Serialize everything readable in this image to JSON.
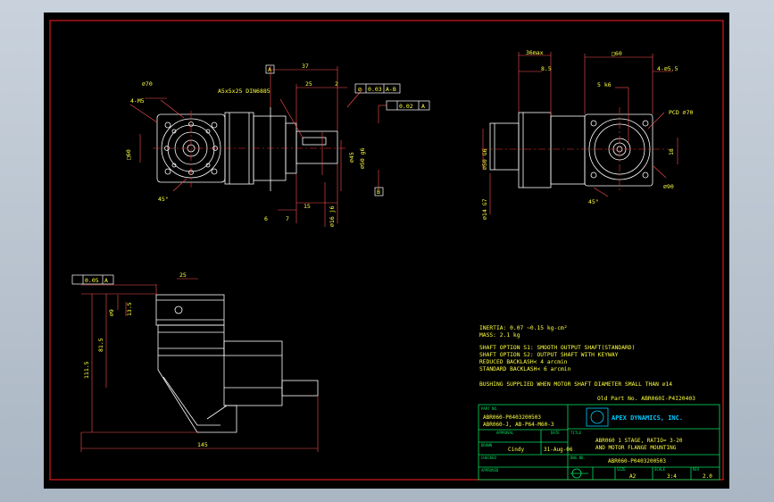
{
  "colors": {
    "app_bg": "#b9c3ce",
    "paper": "#000000",
    "border": "#ff2020",
    "outline": "#ffffff",
    "dim": "#ff5050",
    "text": "#ffff40",
    "green": "#00e060",
    "center": "#ff3030",
    "logo": "#00c8ff"
  },
  "dimensions": {
    "front": {
      "d70": "⌀70",
      "m5": "4-M5",
      "key": "A5x5x25 DIN6885",
      "l37": "37",
      "l25": "25",
      "l2": "2",
      "datumA": "A",
      "geo1": "⌀",
      "geo1v": "0.03",
      "geo1r": "A-B",
      "geo2v": "0.02",
      "geo2r": "A",
      "d45": "⌀45",
      "d50": "⌀50 g6",
      "d16": "⌀16 j6",
      "l15": "15",
      "l6": "6",
      "l7": "7",
      "angle": "45°",
      "datumB": "B",
      "side": "□60"
    },
    "side": {
      "l36": "36max",
      "l85": "8.5",
      "l60": "□60",
      "m55": "4-⌀5.5",
      "key": "5 k6",
      "pcd": "PCD ⌀70",
      "d50": "⌀50 G6",
      "d14": "⌀14 G7",
      "d90": "⌀90",
      "angle": "45°",
      "l18": "18"
    },
    "lower": {
      "tol": "0.05",
      "datum": "A",
      "l25": "25",
      "l135": "13.5",
      "l815": "81.5",
      "l1115": "111.5",
      "l145": "145",
      "d9": "⌀9"
    }
  },
  "notes": [
    "INERTIA:   0.07 ~0.15 kg-cm²",
    "MASS:  2.1 kg",
    "SHAFT OPTION S1: SMOOTH OUTPUT SHAFT(STANDARD)",
    "SHAFT OPTION S2: OUTPUT SHAFT WITH KEYWAY",
    "REDUCED BACKLASH< 4 arcmin",
    "STANDARD BACKLASH< 6 arcmin",
    "BUSHING SUPPLIED WHEN MOTOR SHAFT DIAMETER SMALL THAN ⌀14"
  ],
  "old_part": "Old Part No. ABR060I-P4I20403",
  "title_block": {
    "part_no_label": "PART NO.",
    "part_no_1": "ABR060-P0403200503",
    "part_no_2": "ABR060-J, AB-P64-M60-3",
    "approval_label": "APPROVAL",
    "date_label": "DATE",
    "drawn_label": "DRAWN",
    "drawn_by": "Cindy",
    "drawn_date": "31-Aug-06",
    "checked_label": "CHECKED",
    "approved_label": "APPROVED",
    "company": "APEX DYNAMICS, INC.",
    "title_label": "TITLE",
    "title_1": "ABR060 1 STAGE, RATIO= 3-20",
    "title_2": "AND MOTOR FLANGE MOUNTING",
    "dwg_label": "DWG NO.",
    "dwg_no": "ABR060-P0403200503",
    "size_label": "SIZE",
    "size": "A2",
    "scale_label": "SCALE",
    "scale": "3:4",
    "rev_label": "REV",
    "rev": "2.0"
  }
}
